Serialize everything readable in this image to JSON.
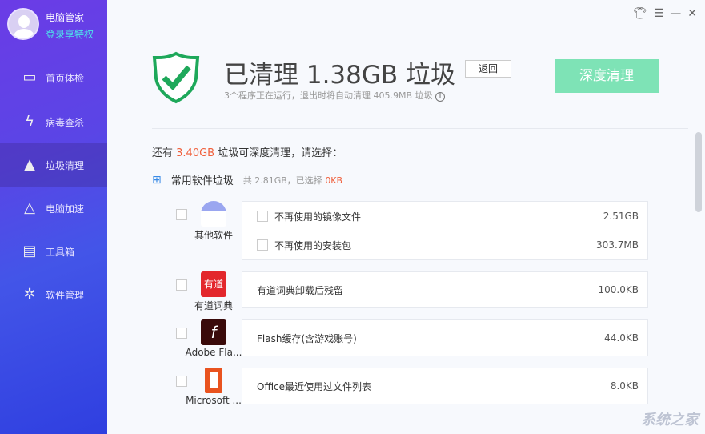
{
  "user": {
    "name": "电脑管家",
    "vip_link": "登录享特权"
  },
  "sidebar": {
    "items": [
      {
        "label": "首页体检",
        "icon": "monitor-icon"
      },
      {
        "label": "病毒查杀",
        "icon": "lightning-shield-icon"
      },
      {
        "label": "垃圾清理",
        "icon": "broom-icon",
        "active": true
      },
      {
        "label": "电脑加速",
        "icon": "rocket-icon"
      },
      {
        "label": "工具箱",
        "icon": "toolbox-icon"
      },
      {
        "label": "软件管理",
        "icon": "apps-icon"
      }
    ]
  },
  "header": {
    "title": "已清理 1.38GB 垃圾",
    "back_label": "返回",
    "subtitle": "3个程序正在运行，退出时将自动清理 405.9MB 垃圾",
    "deep_clean_label": "深度清理"
  },
  "summary": {
    "prefix": "还有 ",
    "amount": "3.40GB",
    "suffix": " 垃圾可深度清理，请选择："
  },
  "category": {
    "name": "常用软件垃圾",
    "total": "共 2.81GB，已选择 ",
    "selected": "0KB"
  },
  "rows": [
    {
      "app": "其他软件",
      "items": [
        {
          "label": "不再使用的镜像文件",
          "size": "2.51GB"
        },
        {
          "label": "不再使用的安装包",
          "size": "303.7MB"
        }
      ]
    },
    {
      "app": "有道词典",
      "logo_text": "有道",
      "items": [
        {
          "label": "有道词典卸载后残留",
          "size": "100.0KB"
        }
      ]
    },
    {
      "app": "Adobe Fla...",
      "logo_text": "f",
      "items": [
        {
          "label": "Flash缓存(含游戏账号)",
          "size": "44.0KB"
        }
      ]
    },
    {
      "app": "Microsoft ...",
      "items": [
        {
          "label": "Office最近使用过文件列表",
          "size": "8.0KB"
        }
      ]
    }
  ],
  "watermark": "系统之家",
  "colors": {
    "accent_green": "#7ee3b6",
    "highlight_red": "#f0603c"
  }
}
